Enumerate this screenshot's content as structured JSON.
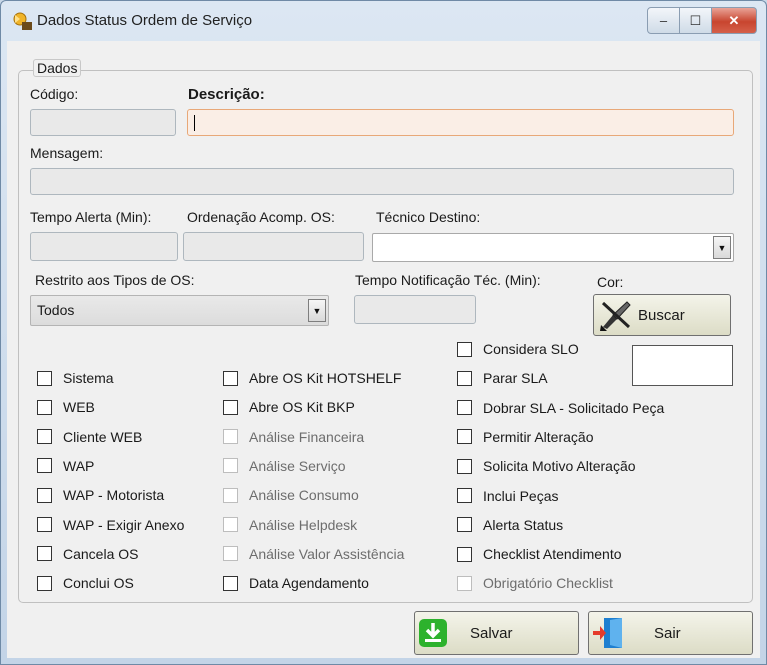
{
  "window": {
    "title": "Dados Status Ordem de Serviço",
    "min": "–",
    "max": "☐",
    "close": "✕"
  },
  "group": {
    "legend": "Dados"
  },
  "fields": {
    "codigo": {
      "label": "Código:",
      "value": ""
    },
    "descricao": {
      "label": "Descrição:",
      "value": ""
    },
    "mensagem": {
      "label": "Mensagem:",
      "value": ""
    },
    "tempo_alerta": {
      "label": "Tempo Alerta (Min):",
      "value": ""
    },
    "ordenacao": {
      "label": "Ordenação Acomp.  OS:",
      "value": ""
    },
    "tecnico": {
      "label": "Técnico Destino:",
      "value": ""
    },
    "restrito": {
      "label": "Restrito aos Tipos de OS:",
      "value": "Todos"
    },
    "tempo_notificacao": {
      "label": "Tempo Notificação Téc. (Min):",
      "value": ""
    },
    "cor": {
      "label": "Cor:",
      "button": "Buscar"
    }
  },
  "checkboxes": {
    "col1": [
      "Sistema",
      "WEB",
      "Cliente WEB",
      "WAP",
      "WAP - Motorista",
      "WAP - Exigir Anexo",
      "Cancela OS",
      "Conclui OS"
    ],
    "col2": [
      "Abre OS Kit HOTSHELF",
      "Abre OS Kit BKP",
      "Análise Financeira",
      "Análise Serviço",
      "Análise Consumo",
      "Análise Helpdesk",
      "Análise Valor Assistência",
      "Data Agendamento"
    ],
    "col3": [
      "Considera SLO",
      "Parar SLA",
      "Dobrar SLA - Solicitado Peça",
      "Permitir Alteração",
      "Solicita Motivo Alteração",
      "Inclui Peças",
      "Alerta Status",
      "Checklist Atendimento",
      "Obrigatório Checklist"
    ]
  },
  "footer": {
    "save": "Salvar",
    "exit": "Sair"
  },
  "colors": {
    "accent_focus": "#e8a878",
    "save_icon": "#2db22d",
    "exit_icon": "#1e7fd0"
  }
}
